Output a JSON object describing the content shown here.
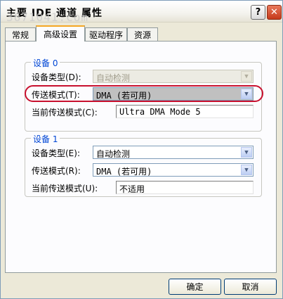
{
  "window": {
    "title": "主要 IDE 通道 属性",
    "watermark": "3671041.com",
    "help_glyph": "?",
    "close_glyph": "✕"
  },
  "tabs": [
    "常规",
    "高级设置",
    "驱动程序",
    "资源"
  ],
  "active_tab": "高级设置",
  "device0": {
    "legend": "设备 0",
    "device_type_label": "设备类型(D):",
    "device_type_value": "自动检测",
    "transfer_mode_label": "传送模式(T):",
    "transfer_mode_value": "DMA (若可用)",
    "current_mode_label": "当前传送模式(C):",
    "current_mode_value": "Ultra DMA Mode 5"
  },
  "device1": {
    "legend": "设备 1",
    "device_type_label": "设备类型(E):",
    "device_type_value": "自动检测",
    "transfer_mode_label": "传送模式(R):",
    "transfer_mode_value": "DMA (若可用)",
    "current_mode_label": "当前传送模式(U):",
    "current_mode_value": "不适用"
  },
  "buttons": {
    "ok": "确定",
    "cancel": "取消"
  },
  "dropdown_arrow": "▼",
  "colors": {
    "highlight": "#c8102e",
    "legend": "#0046d5",
    "active_tab_accent": "#f5a623"
  }
}
